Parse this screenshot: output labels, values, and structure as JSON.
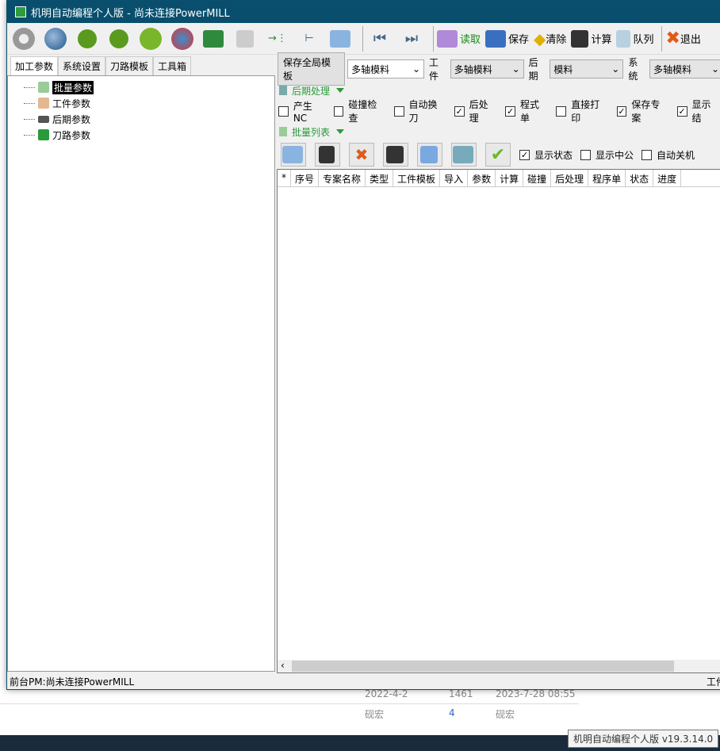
{
  "window": {
    "title": "机明自动编程个人版 - 尚未连接PowerMILL"
  },
  "toolbar": {
    "icons": [
      "gear-icon",
      "globe-icon",
      "add-icon",
      "add-icon",
      "chip-icon",
      "arrow-globe-icon",
      "excel-icon",
      "wrench-icon",
      "import-icon",
      "tree-icon",
      "folder-icon",
      "first-icon",
      "last-icon"
    ],
    "read": "读取",
    "save": "保存",
    "clear": "清除",
    "compute": "计算",
    "queue": "队列",
    "exit": "退出"
  },
  "left": {
    "tabs": [
      "加工参数",
      "系统设置",
      "刀路模板",
      "工具箱"
    ],
    "tree": [
      "批量参数",
      "工件参数",
      "后期参数",
      "刀路参数"
    ]
  },
  "right": {
    "save_template": "保存全局模板",
    "template_value": "多轴模料",
    "workpiece_label": "工件",
    "workpiece_value": "多轴模料",
    "post_label": "后期",
    "post_value": "模料",
    "system_label": "系统",
    "system_value": "多轴模料",
    "post_section": "后期处理",
    "options": [
      {
        "label": "产生NC",
        "checked": false
      },
      {
        "label": "碰撞检查",
        "checked": false
      },
      {
        "label": "自动换刀",
        "checked": false
      },
      {
        "label": "后处理",
        "checked": true
      },
      {
        "label": "程式单",
        "checked": true
      },
      {
        "label": "直接打印",
        "checked": false
      },
      {
        "label": "保存专案",
        "checked": true
      },
      {
        "label": "显示结",
        "checked": true
      }
    ],
    "batch_section": "批量列表",
    "batch_options": [
      {
        "label": "显示状态",
        "checked": true
      },
      {
        "label": "显示中公",
        "checked": false
      },
      {
        "label": "自动关机",
        "checked": false
      }
    ],
    "columns": [
      "*",
      "序号",
      "专案名称",
      "类型",
      "工件模板",
      "导入",
      "参数",
      "计算",
      "碰撞",
      "后处理",
      "程序单",
      "状态",
      "进度"
    ]
  },
  "status": {
    "left": "前台PM:尚未连接PowerMILL",
    "right": "工件"
  },
  "background": {
    "row1": [
      "2022-4-2",
      "1461",
      "2023-7-28 08:55"
    ],
    "row2": [
      "砚宏",
      "4",
      "砚宏"
    ]
  },
  "tooltip": "机明自动编程个人版 v19.3.14.0"
}
